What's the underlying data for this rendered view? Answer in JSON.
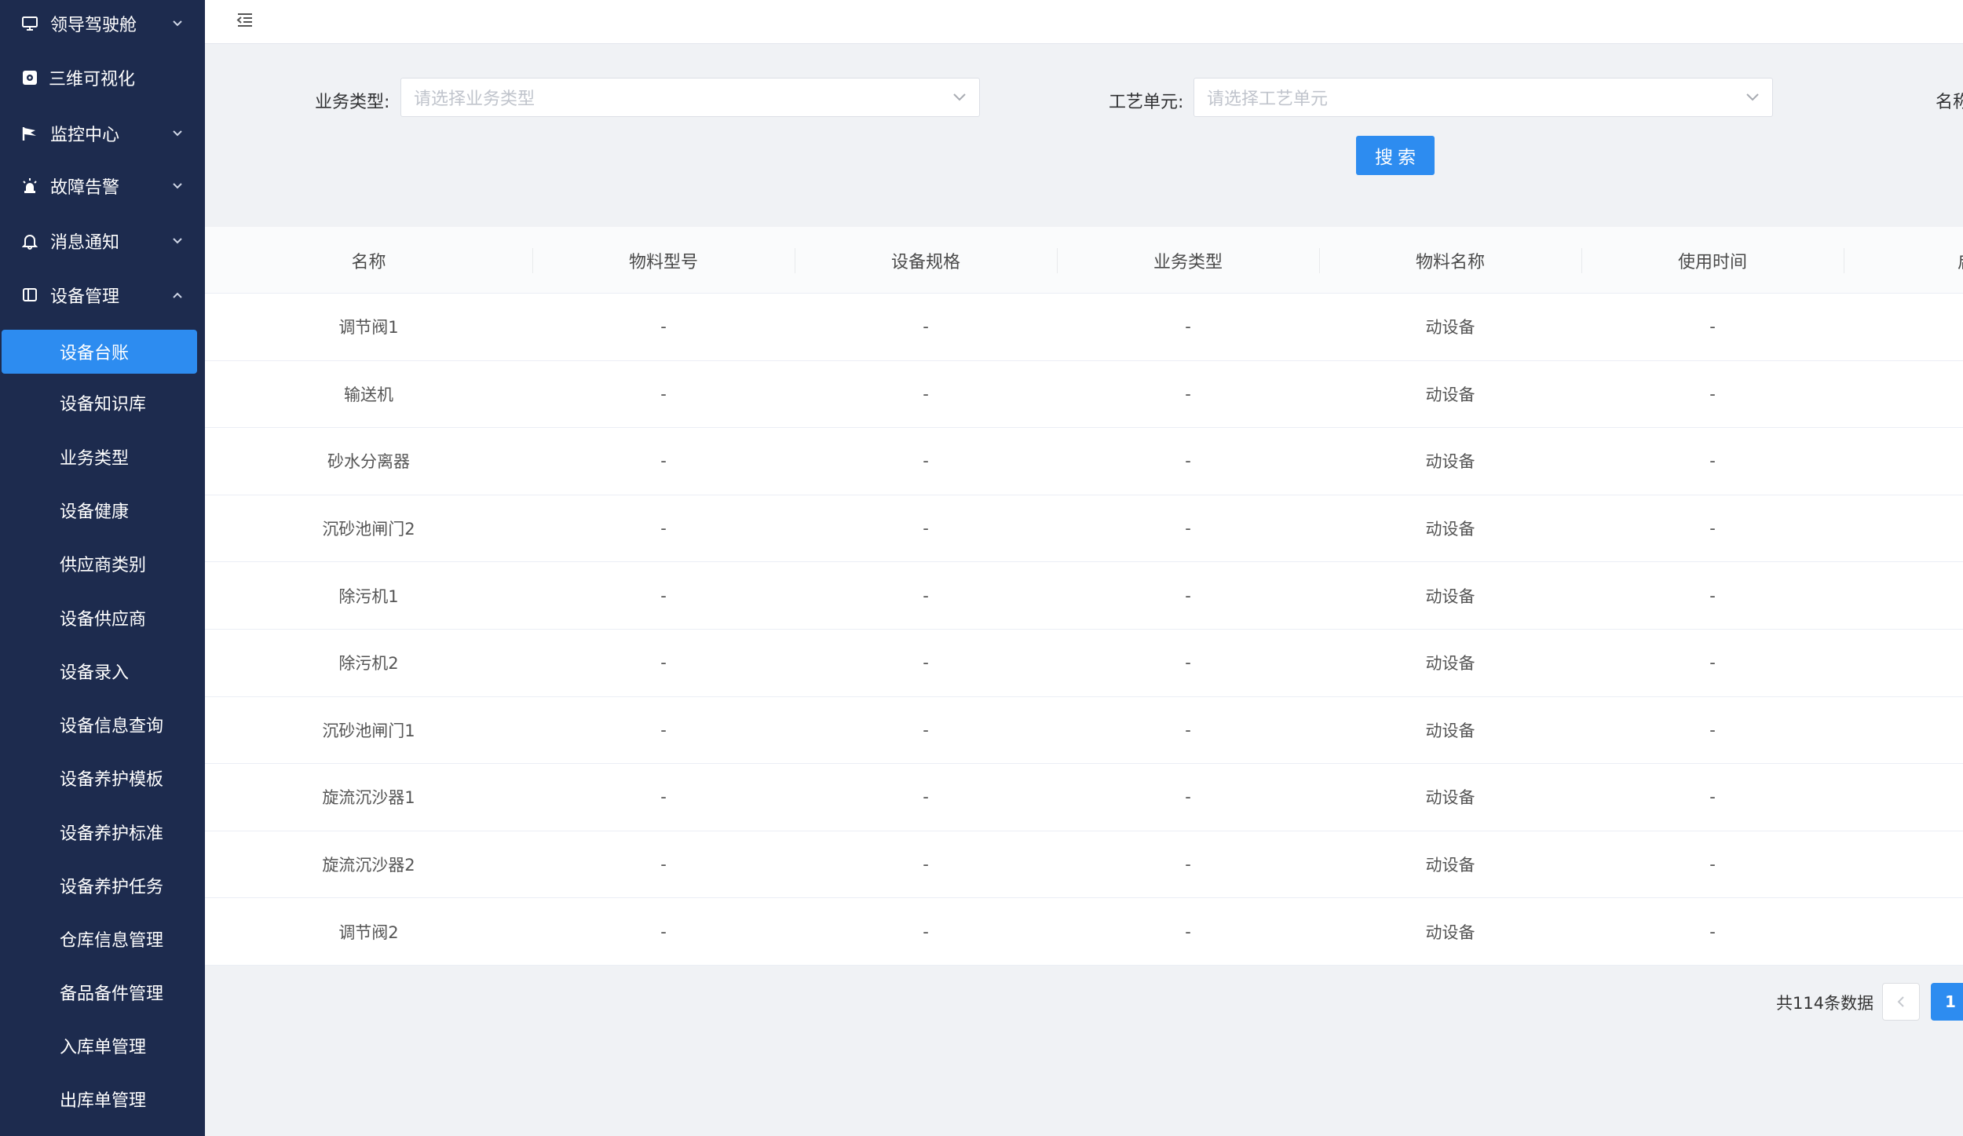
{
  "sidebar": {
    "menus": [
      {
        "label": "领导驾驶舱",
        "icon": "monitor-icon",
        "chevron": "down"
      },
      {
        "label": "三维可视化",
        "icon": "cube-icon",
        "chevron": ""
      },
      {
        "label": "监控中心",
        "icon": "flag-icon",
        "chevron": "down"
      },
      {
        "label": "故障告警",
        "icon": "alarm-light-icon",
        "chevron": "down"
      },
      {
        "label": "消息通知",
        "icon": "bell-icon",
        "chevron": "down"
      },
      {
        "label": "设备管理",
        "icon": "device-icon",
        "chevron": "up"
      }
    ],
    "sub_items": [
      {
        "label": "设备台账",
        "active": true
      },
      {
        "label": "设备知识库"
      },
      {
        "label": "业务类型"
      },
      {
        "label": "设备健康"
      },
      {
        "label": "供应商类别"
      },
      {
        "label": "设备供应商"
      },
      {
        "label": "设备录入"
      },
      {
        "label": "设备信息查询"
      },
      {
        "label": "设备养护模板"
      },
      {
        "label": "设备养护标准"
      },
      {
        "label": "设备养护任务"
      },
      {
        "label": "仓库信息管理"
      },
      {
        "label": "备品备件管理"
      },
      {
        "label": "入库单管理"
      },
      {
        "label": "出库单管理"
      }
    ]
  },
  "topbar": {
    "fold_icon": "menu-fold-icon"
  },
  "search": {
    "business_type_label": "业务类型:",
    "business_type_placeholder": "请选择业务类型",
    "process_unit_label": "工艺单元:",
    "process_unit_placeholder": "请选择工艺单元",
    "name_label_partial": "名称",
    "search_button": "搜索"
  },
  "table": {
    "columns": [
      "名称",
      "物料型号",
      "设备规格",
      "业务类型",
      "物料名称",
      "使用时间",
      "启用"
    ],
    "rows": [
      [
        "调节阀1",
        "-",
        "-",
        "-",
        "动设备",
        "-"
      ],
      [
        "输送机",
        "-",
        "-",
        "-",
        "动设备",
        "-"
      ],
      [
        "砂水分离器",
        "-",
        "-",
        "-",
        "动设备",
        "-"
      ],
      [
        "沉砂池闸门2",
        "-",
        "-",
        "-",
        "动设备",
        "-"
      ],
      [
        "除污机1",
        "-",
        "-",
        "-",
        "动设备",
        "-"
      ],
      [
        "除污机2",
        "-",
        "-",
        "-",
        "动设备",
        "-"
      ],
      [
        "沉砂池闸门1",
        "-",
        "-",
        "-",
        "动设备",
        "-"
      ],
      [
        "旋流沉沙器1",
        "-",
        "-",
        "-",
        "动设备",
        "-"
      ],
      [
        "旋流沉沙器2",
        "-",
        "-",
        "-",
        "动设备",
        "-"
      ],
      [
        "调节阀2",
        "-",
        "-",
        "-",
        "动设备",
        "-"
      ]
    ]
  },
  "pagination": {
    "total_text": "共114条数据",
    "current_page": "1"
  },
  "colors": {
    "sidebar_bg": "#1d2b4e",
    "accent": "#2d8cf0",
    "page_bg": "#f0f2f5"
  }
}
